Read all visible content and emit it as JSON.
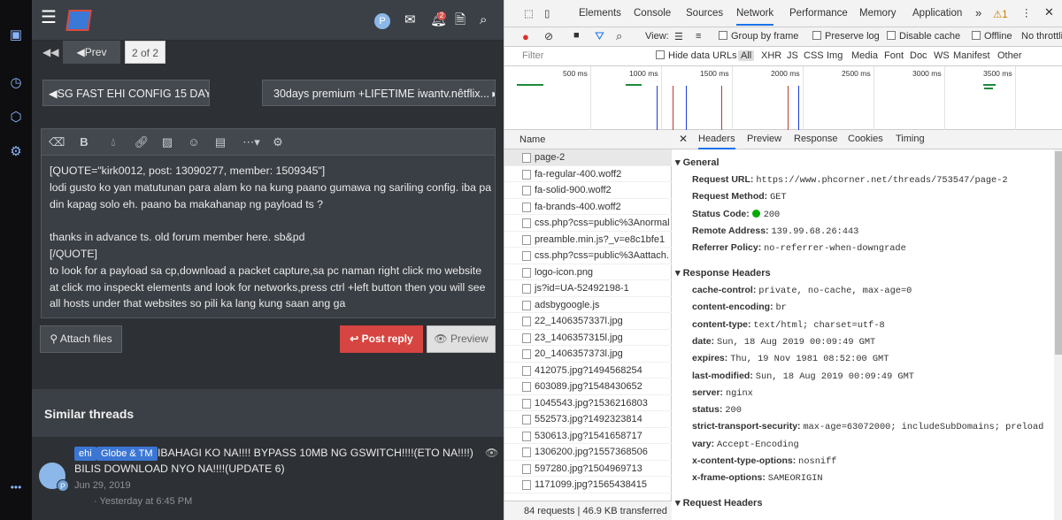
{
  "forum": {
    "pager": {
      "first": "◀◀",
      "prev": "◀Prev",
      "current": "2 of 2"
    },
    "nav": {
      "prev_thread": "◀SG FAST EHI CONFIG 15 DAYS",
      "next_thread": "30days premium +LIFETIME iwantv.nêtflix... ▸"
    },
    "user_initial": "P",
    "notif_count": "2",
    "editor_text": "[QUOTE=\"kirk0012, post: 13090277, member: 1509345\"]\nlodi gusto ko yan matutunan para alam ko na kung paano gumawa ng sariling config. iba pa din kapag solo eh. paano ba makahanap ng payload ts ?\n\nthanks in advance ts. old forum member here. sb&pd\n[/QUOTE]\nto look for a payload sa cp,download a packet capture,sa pc naman right click mo website at click mo inspeckt elements and look for networks,press ctrl +left button then you will see all hosts under that websites so pili ka lang kung saan ang ga",
    "attach_label": "Attach files",
    "post_label": "Post reply",
    "preview_label": "Preview",
    "similar_heading": "Similar threads",
    "similar": {
      "tags": [
        "ehi",
        "Globe & TM"
      ],
      "title": "IBAHAGI KO NA!!!! BYPASS 10MB NG GSWITCH!!!!(ETO NA!!!!) BILIS DOWNLOAD NYO NA!!!!(UPDATE 6)",
      "date": "Jun 29, 2019",
      "last": "· Yesterday at 6:45 PM",
      "avatar_initial": "P"
    }
  },
  "devtools": {
    "tabs": [
      "Elements",
      "Console",
      "Sources",
      "Network",
      "Performance",
      "Memory",
      "Application"
    ],
    "more": "»",
    "warn": "⚠1",
    "view_label": "View:",
    "group_by_frame": "Group by frame",
    "preserve_log": "Preserve log",
    "disable_cache": "Disable cache",
    "offline": "Offline",
    "throttle": "No throttli",
    "filter_placeholder": "Filter",
    "hide_data_urls": "Hide data URLs",
    "types": [
      "All",
      "XHR",
      "JS",
      "CSS",
      "Img",
      "Media",
      "Font",
      "Doc",
      "WS",
      "Manifest",
      "Other"
    ],
    "timeline_labels": [
      "500 ms",
      "1000 ms",
      "1500 ms",
      "2000 ms",
      "2500 ms",
      "3000 ms",
      "3500 ms"
    ],
    "name_header": "Name",
    "requests": [
      "page-2",
      "fa-regular-400.woff2",
      "fa-solid-900.woff2",
      "fa-brands-400.woff2",
      "css.php?css=public%3Anormal",
      "preamble.min.js?_v=e8c1bfe1",
      "css.php?css=public%3Aattach.",
      "logo-icon.png",
      "js?id=UA-52492198-1",
      "adsbygoogle.js",
      "22_1406357337l.jpg",
      "23_1406357315l.jpg",
      "20_1406357373l.jpg",
      "412075.jpg?1494568254",
      "603089.jpg?1548430652",
      "1045543.jpg?1536216803",
      "552573.jpg?1492323814",
      "530613.jpg?1541658717",
      "1306200.jpg?1557368506",
      "597280.jpg?1504969713",
      "1171099.jpg?1565438415"
    ],
    "footer_requests": "84 requests",
    "footer_transferred": "46.9 KB transferred",
    "detail_tabs": [
      "Headers",
      "Preview",
      "Response",
      "Cookies",
      "Timing"
    ],
    "general_title": "▾ General",
    "general": [
      {
        "k": "Request URL:",
        "v": "https://www.phcorner.net/threads/753547/page-2"
      },
      {
        "k": "Request Method:",
        "v": "GET"
      },
      {
        "k": "Status Code:",
        "v": "200"
      },
      {
        "k": "Remote Address:",
        "v": "139.99.68.26:443"
      },
      {
        "k": "Referrer Policy:",
        "v": "no-referrer-when-downgrade"
      }
    ],
    "response_title": "▾ Response Headers",
    "response": [
      {
        "k": "cache-control:",
        "v": "private, no-cache, max-age=0"
      },
      {
        "k": "content-encoding:",
        "v": "br"
      },
      {
        "k": "content-type:",
        "v": "text/html; charset=utf-8"
      },
      {
        "k": "date:",
        "v": "Sun, 18 Aug 2019 00:09:49 GMT"
      },
      {
        "k": "expires:",
        "v": "Thu, 19 Nov 1981 08:52:00 GMT"
      },
      {
        "k": "last-modified:",
        "v": "Sun, 18 Aug 2019 00:09:49 GMT"
      },
      {
        "k": "server:",
        "v": "nginx"
      },
      {
        "k": "status:",
        "v": "200"
      },
      {
        "k": "strict-transport-security:",
        "v": "max-age=63072000; includeSubDomains; preload"
      },
      {
        "k": "vary:",
        "v": "Accept-Encoding"
      },
      {
        "k": "x-content-type-options:",
        "v": "nosniff"
      },
      {
        "k": "x-frame-options:",
        "v": "SAMEORIGIN"
      }
    ],
    "request_title": "▾ Request Headers"
  }
}
